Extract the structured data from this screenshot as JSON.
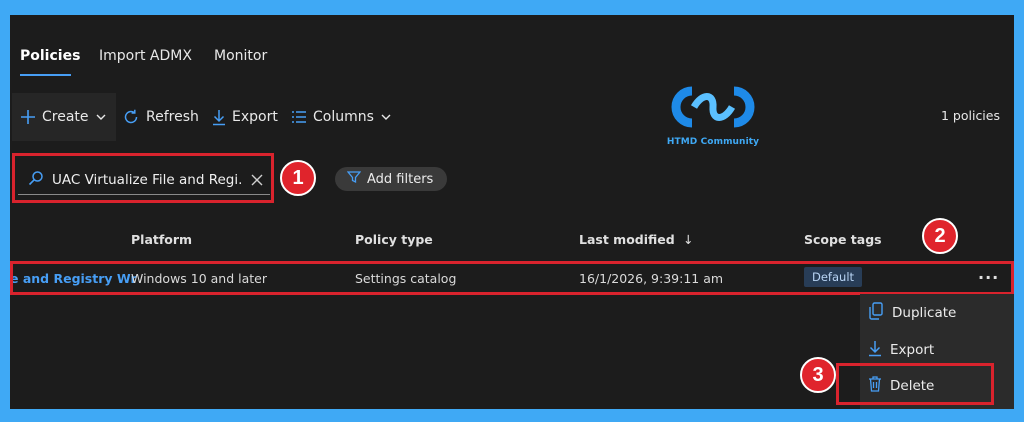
{
  "tabs": [
    {
      "label": "Policies",
      "active": true
    },
    {
      "label": "Import ADMX",
      "active": false
    },
    {
      "label": "Monitor",
      "active": false
    }
  ],
  "toolbar": {
    "create_label": "Create",
    "refresh_label": "Refresh",
    "export_label": "Export",
    "columns_label": "Columns",
    "policy_count": "1 policies"
  },
  "logo": {
    "caption": "HTMD Community"
  },
  "search": {
    "value": "UAC Virtualize File and Regi..."
  },
  "filters": {
    "add_label": "Add filters"
  },
  "table": {
    "columns": [
      "Platform",
      "Policy type",
      "Last modified",
      "Scope tags"
    ],
    "rows": [
      {
        "name": "e and Registry Wr",
        "platform": "Windows 10 and later",
        "policy_type": "Settings catalog",
        "last_modified": "16/1/2026, 9:39:11 am",
        "scope_tag": "Default"
      }
    ]
  },
  "context_menu": {
    "items": [
      "Duplicate",
      "Export",
      "Delete"
    ]
  },
  "annotations": [
    "1",
    "2",
    "3"
  ],
  "colors": {
    "accent": "#479ef5",
    "highlight_red": "#d9232d",
    "frame_blue": "#3fa9f5",
    "background": "#1c1c1c"
  }
}
